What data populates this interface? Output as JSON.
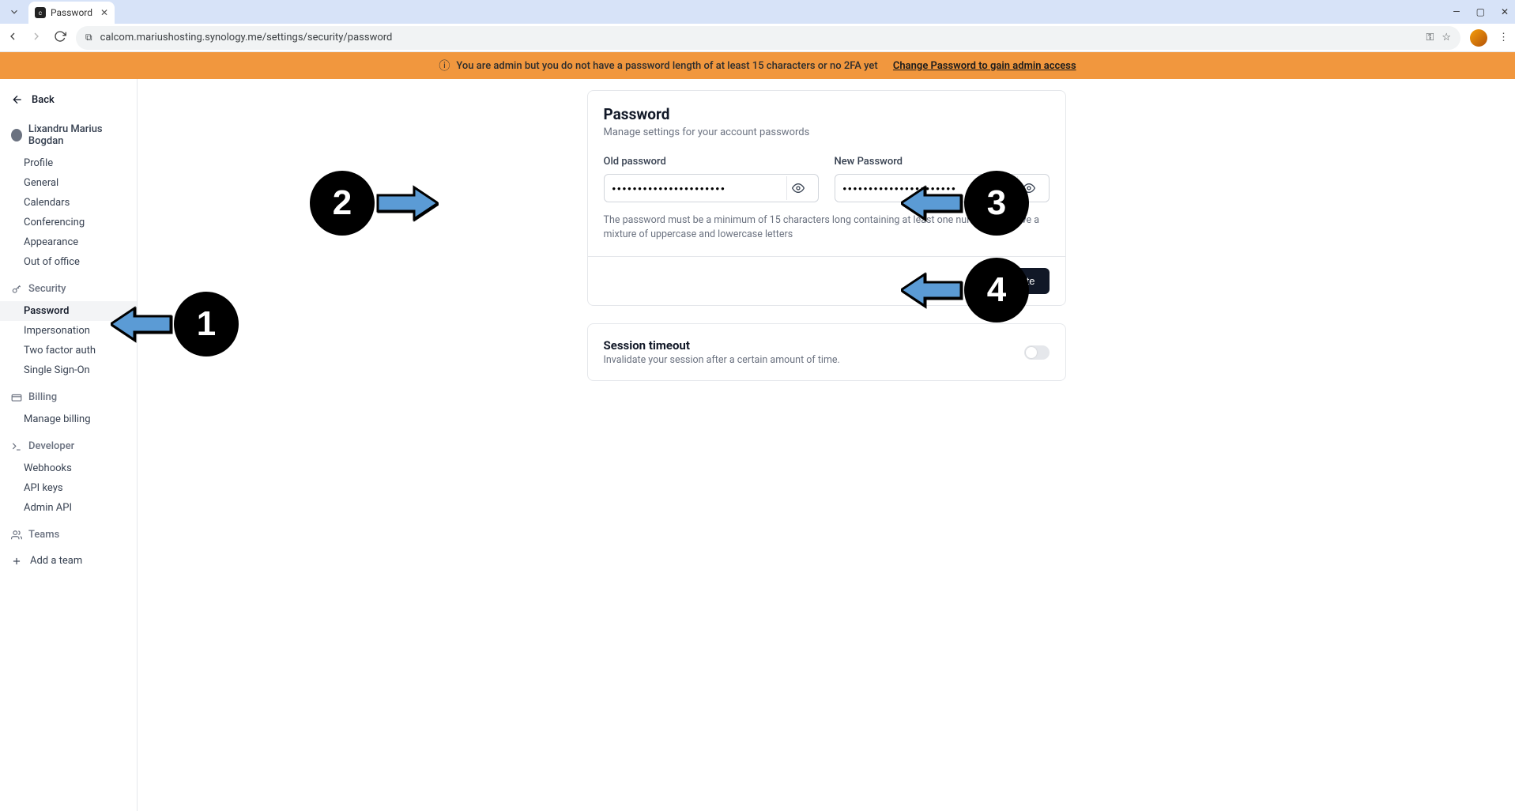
{
  "browser": {
    "tab_title": "Password",
    "url": "calcom.mariushosting.synology.me/settings/security/password"
  },
  "banner": {
    "text": "You are admin but you do not have a password length of at least 15 characters or no 2FA yet",
    "link": "Change Password to gain admin access"
  },
  "sidebar": {
    "back": "Back",
    "user_name": "Lixandru Marius Bogdan",
    "items_user": [
      "Profile",
      "General",
      "Calendars",
      "Conferencing",
      "Appearance",
      "Out of office"
    ],
    "security_header": "Security",
    "items_security": [
      "Password",
      "Impersonation",
      "Two factor auth",
      "Single Sign-On"
    ],
    "billing_header": "Billing",
    "items_billing": [
      "Manage billing"
    ],
    "developer_header": "Developer",
    "items_developer": [
      "Webhooks",
      "API keys",
      "Admin API"
    ],
    "teams_header": "Teams",
    "add_team": "Add a team"
  },
  "password_card": {
    "title": "Password",
    "subtitle": "Manage settings for your account passwords",
    "old_label": "Old password",
    "new_label": "New Password",
    "old_value": "••••••••••••••••••••••",
    "new_value": "••••••••••••••••••••••",
    "help": "The password must be a minimum of 15 characters long containing at least one number and have a mixture of uppercase and lowercase letters",
    "update": "Update"
  },
  "session_card": {
    "title": "Session timeout",
    "subtitle": "Invalidate your session after a certain amount of time."
  },
  "annotations": {
    "a1": "1",
    "a2": "2",
    "a3": "3",
    "a4": "4"
  }
}
